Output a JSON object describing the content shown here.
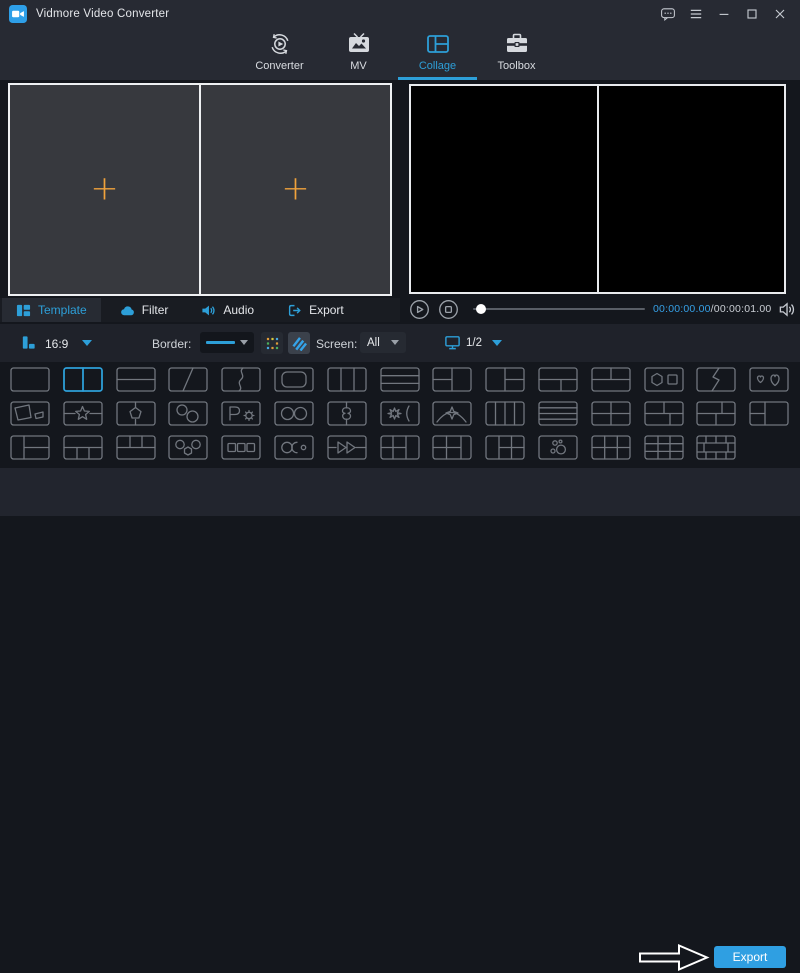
{
  "window_title": "Vidmore Video Converter",
  "titlebar": {
    "controls": [
      {
        "name": "feedback",
        "icon": "feedback-icon"
      },
      {
        "name": "menu",
        "icon": "menu-icon"
      },
      {
        "name": "minimize",
        "icon": "minimize-icon"
      },
      {
        "name": "maximize",
        "icon": "maximize-icon"
      },
      {
        "name": "close",
        "icon": "close-icon"
      }
    ]
  },
  "nav_tabs": [
    {
      "id": "converter",
      "label": "Converter",
      "active": false
    },
    {
      "id": "mv",
      "label": "MV",
      "active": false
    },
    {
      "id": "collage",
      "label": "Collage",
      "active": true
    },
    {
      "id": "toolbox",
      "label": "Toolbox",
      "active": false
    }
  ],
  "collage_editor": {
    "cells": [
      {
        "placeholder": "+"
      },
      {
        "placeholder": "+"
      }
    ]
  },
  "editor_tabs": [
    {
      "id": "template",
      "label": "Template",
      "active": true
    },
    {
      "id": "filter",
      "label": "Filter",
      "active": false
    },
    {
      "id": "audio",
      "label": "Audio",
      "active": false
    },
    {
      "id": "export",
      "label": "Export",
      "active": false
    }
  ],
  "player": {
    "current_time": "00:00:00.00",
    "time_separator": "/",
    "total_duration": "00:00:01.00",
    "progress_percent": 2
  },
  "toolbar": {
    "aspect_ratio": "16:9",
    "border_label": "Border:",
    "screen_label": "Screen:",
    "screen_value": "All",
    "page_indicator": "1/2"
  },
  "template_grid": {
    "selected": "two-columns",
    "rows": [
      [
        "single",
        "two-columns",
        "two-rows",
        "diagonal-split",
        "wave-split",
        "rounded-inset",
        "three-columns",
        "three-rows",
        "two-col-left-rows",
        "two-col-right-rows",
        "two-row-bottom-cols",
        "two-row-top-cols",
        "hex-square",
        "lightning-split",
        "two-hearts"
      ],
      [
        "megaphones",
        "star-band",
        "pentagon-split",
        "two-circles",
        "p-gear",
        "two-ovals",
        "clover-split",
        "burst-bracket",
        "arc-star",
        "four-columns",
        "four-rows",
        "grid-2x2",
        "grid-2x2-top-offset",
        "grid-2x2-bottom-offset",
        "left-rows-right-col"
      ],
      [
        "left-col-right-rows",
        "top-full-bottom-3cols",
        "top-3cols-bottom-full",
        "three-bubbles",
        "three-squares",
        "circle-pac-dot",
        "play-arrows",
        "grid-2x2-right-col",
        "grid-2x2-right-col-wide",
        "left-col-grid-2x2",
        "bubbles-scatter",
        "grid-3x2",
        "grid-3x3",
        "grid-frame"
      ]
    ]
  },
  "footer": {
    "export_label": "Export"
  },
  "colors": {
    "accent": "#2d9fd8",
    "add_plus": "#f0a23c",
    "export_button": "#2f9fe2",
    "panel_border": "#eef0f2",
    "collage_cell": "#37393e"
  }
}
